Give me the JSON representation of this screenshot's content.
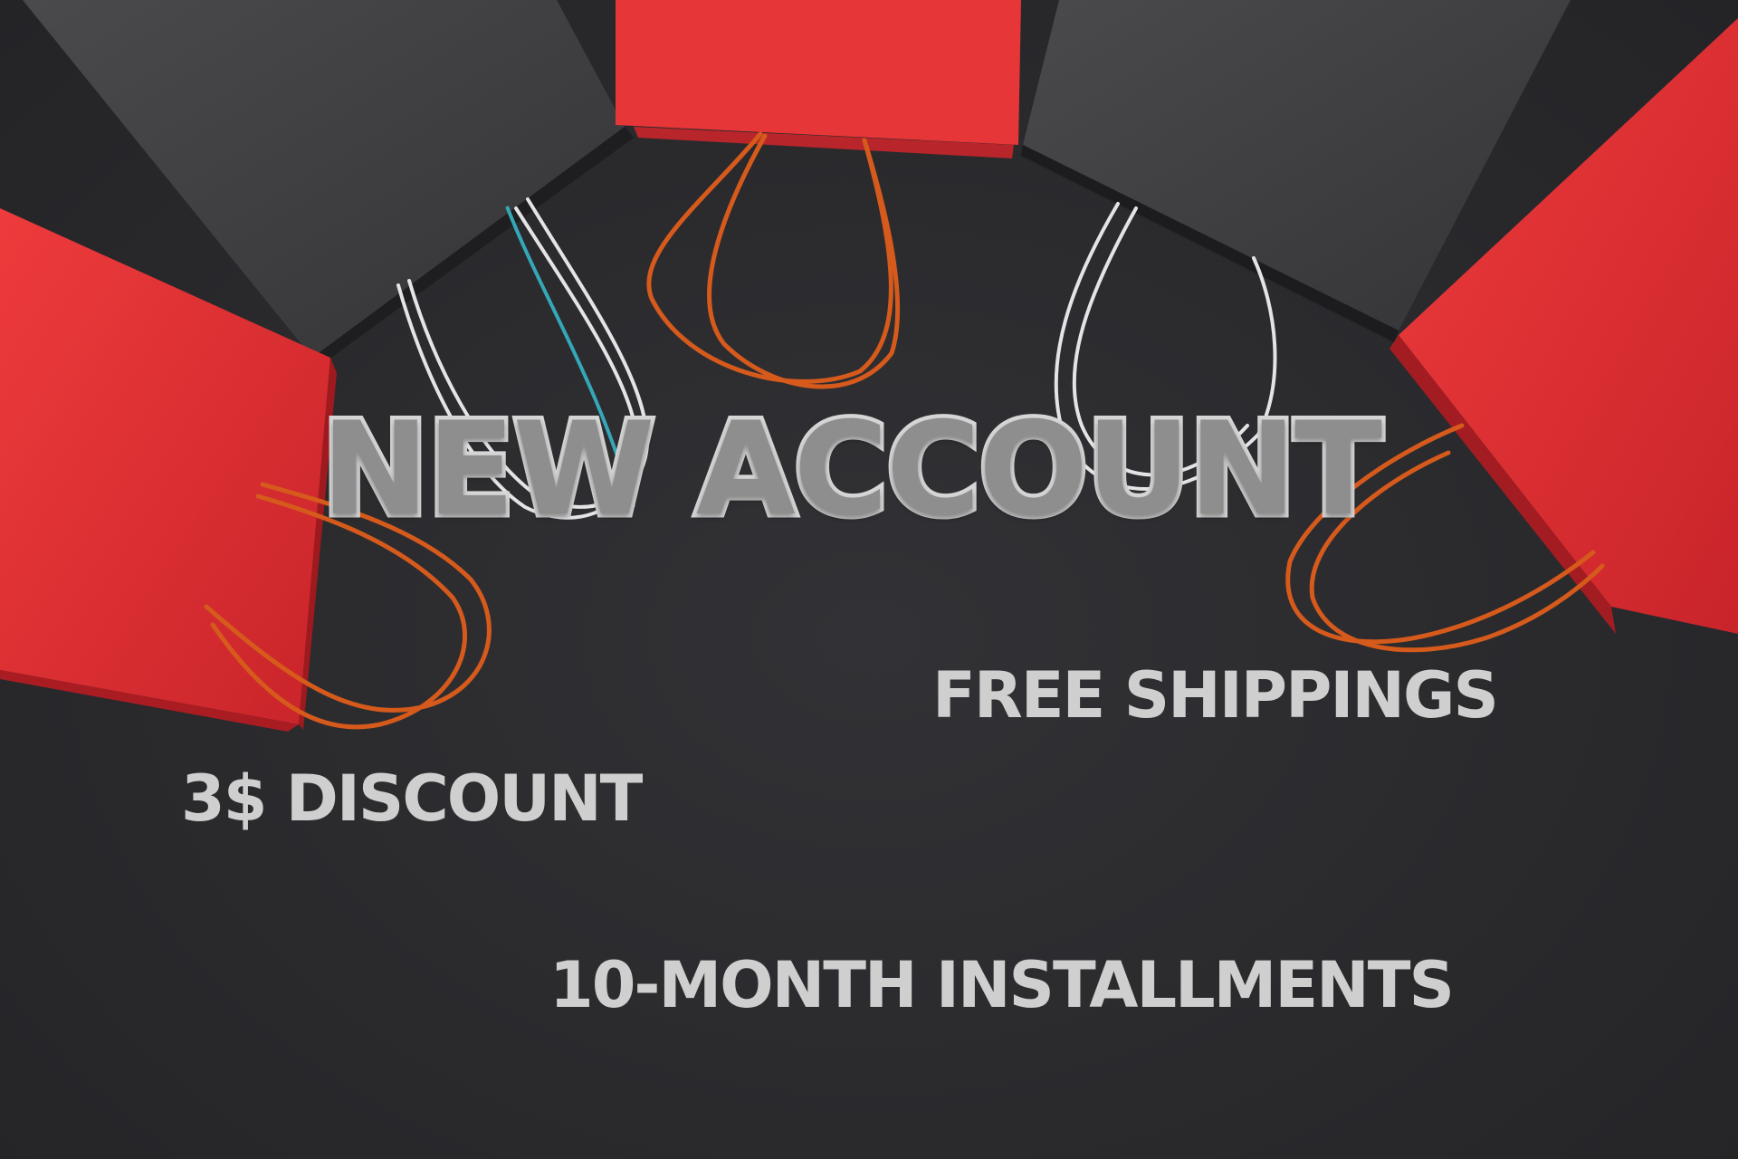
{
  "promo": {
    "headline": "NEW ACCOUNT",
    "perks": {
      "shipping": "FREE SHIPPINGS",
      "discount": "3$ DISCOUNT",
      "installments": "10-MONTH INSTALLMENTS"
    }
  },
  "colors": {
    "background": "#2b2b2e",
    "bag_red": "#e63436",
    "bag_gray": "#3d3d3f",
    "handle_orange": "#d65a1c",
    "handle_white": "#e4e4e6",
    "text_light": "#cfcfcf"
  }
}
